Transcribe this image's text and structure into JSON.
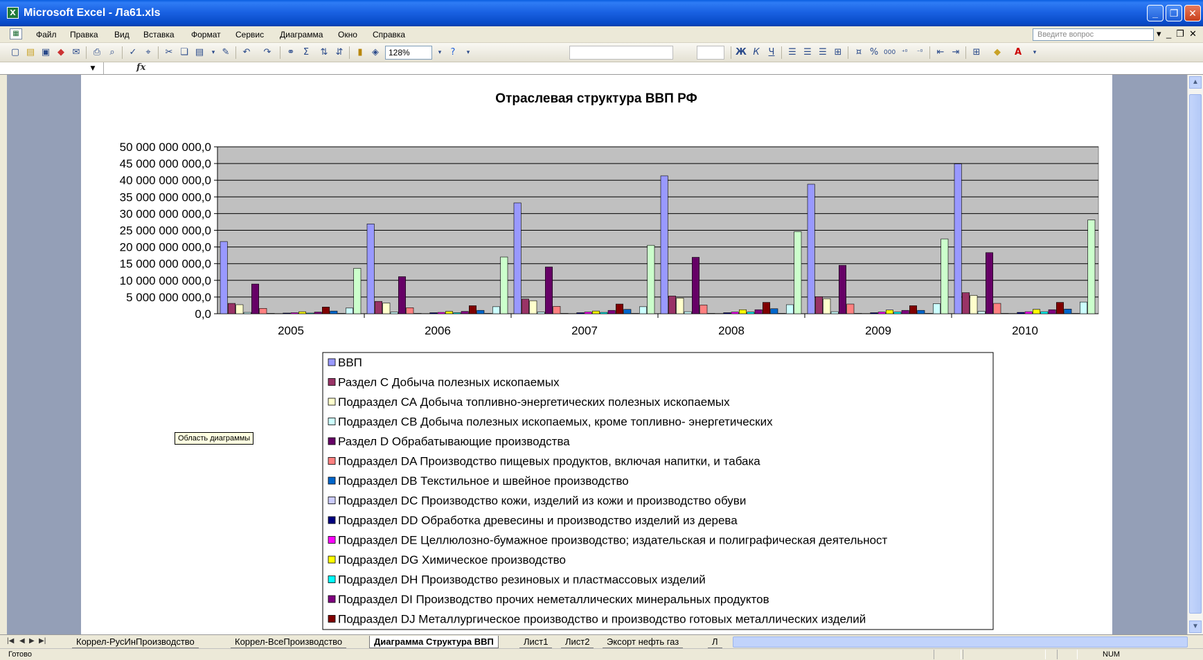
{
  "window": {
    "title": "Microsoft Excel - Ла61.xls",
    "app_icon": "excel-icon"
  },
  "menu": {
    "items": [
      "Файл",
      "Правка",
      "Вид",
      "Вставка",
      "Формат",
      "Сервис",
      "Диаграмма",
      "Окно",
      "Справка"
    ],
    "help_placeholder": "Введите вопрос"
  },
  "toolbar": {
    "zoom": "128%"
  },
  "formula_bar": {
    "fx_label": "fx"
  },
  "chart_data": {
    "type": "bar",
    "title": "Отраслевая структура ВВП РФ",
    "categories": [
      "2005",
      "2006",
      "2007",
      "2008",
      "2009",
      "2010"
    ],
    "ylim": [
      0,
      50000000000
    ],
    "yticks": [
      "0,0",
      "5 000 000 000,0",
      "10 000 000 000,0",
      "15 000 000 000,0",
      "20 000 000 000,0",
      "25 000 000 000,0",
      "30 000 000 000,0",
      "35 000 000 000,0",
      "40 000 000 000,0",
      "45 000 000 000,0",
      "50 000 000 000,0"
    ],
    "plot_background": "#c0c0c0",
    "gridlines": true,
    "legend_position": "bottom",
    "series": [
      {
        "name": "ВВП",
        "color": "#9999ff",
        "values": [
          21600000000,
          26900000000,
          33200000000,
          41300000000,
          38800000000,
          44900000000
        ]
      },
      {
        "name": "Раздел С Добыча полезных ископаемых",
        "color": "#993366",
        "values": [
          3100000000,
          3700000000,
          4400000000,
          5300000000,
          5100000000,
          6300000000
        ]
      },
      {
        "name": "Подраздел СА Добыча топливно-энергетических полезных ископаемых",
        "color": "#ffffcc",
        "values": [
          2700000000,
          3200000000,
          3900000000,
          4700000000,
          4500000000,
          5500000000
        ]
      },
      {
        "name": "Подраздел СВ Добыча полезных ископаемых, кроме топливно- энергетических",
        "color": "#ccffff",
        "values": [
          400000000,
          500000000,
          500000000,
          600000000,
          600000000,
          700000000
        ]
      },
      {
        "name": "Раздел D Обрабатывающие производства",
        "color": "#660066",
        "values": [
          8900000000,
          11100000000,
          14000000000,
          16900000000,
          14500000000,
          18300000000
        ]
      },
      {
        "name": "Подраздел DA Производство пищевых продуктов, включая напитки, и табака",
        "color": "#ff8080",
        "values": [
          1600000000,
          1800000000,
          2200000000,
          2600000000,
          2900000000,
          3100000000
        ]
      },
      {
        "name": "Подраздел DB Текстильное и швейное производство",
        "color": "#0066cc",
        "values": [
          100000000,
          100000000,
          100000000,
          100000000,
          100000000,
          100000000
        ]
      },
      {
        "name": "Подраздел DC Производство кожи, изделий из кожи и производство обуви",
        "color": "#ccccff",
        "values": [
          50000000,
          50000000,
          50000000,
          60000000,
          60000000,
          70000000
        ]
      },
      {
        "name": "Подраздел DD Обработка древесины и производство изделий из дерева",
        "color": "#000080",
        "values": [
          200000000,
          300000000,
          300000000,
          300000000,
          300000000,
          400000000
        ]
      },
      {
        "name": "Подраздел DE Целлюлозно-бумажное производство; издательская и полиграфическая деятельност",
        "color": "#ff00ff",
        "values": [
          300000000,
          400000000,
          500000000,
          500000000,
          500000000,
          600000000
        ]
      },
      {
        "name": "Подраздел DG Химическое производство",
        "color": "#ffff00",
        "values": [
          600000000,
          700000000,
          800000000,
          1200000000,
          1100000000,
          1300000000
        ]
      },
      {
        "name": "Подраздел DH Производство резиновых и пластмассовых изделий",
        "color": "#00ffff",
        "values": [
          200000000,
          300000000,
          400000000,
          500000000,
          500000000,
          600000000
        ]
      },
      {
        "name": "Подраздел DI Производство прочих неметаллических минеральных продуктов",
        "color": "#800080",
        "values": [
          500000000,
          700000000,
          1000000000,
          1200000000,
          1000000000,
          1200000000
        ]
      },
      {
        "name": "Подраздел DJ Металлургическое производство и производство готовых металлических изделий",
        "color": "#800000",
        "values": [
          2000000000,
          2400000000,
          2900000000,
          3400000000,
          2400000000,
          3400000000
        ]
      },
      {
        "name": "",
        "color": "#0066cc",
        "values": [
          800000000,
          1000000000,
          1300000000,
          1500000000,
          1000000000,
          1400000000
        ]
      },
      {
        "name": "",
        "color": "#c0c0c0",
        "values": [
          100000000,
          100000000,
          100000000,
          100000000,
          100000000,
          100000000
        ]
      },
      {
        "name": "",
        "color": "#ccffff",
        "values": [
          1700000000,
          2100000000,
          2100000000,
          2700000000,
          3000000000,
          3500000000
        ]
      },
      {
        "name": "",
        "color": "#ccffcc",
        "values": [
          13600000000,
          17000000000,
          20500000000,
          24600000000,
          22400000000,
          28100000000
        ]
      }
    ]
  },
  "tooltip": "Область диаграммы",
  "sheet_tabs": [
    "Коррел-РусИнПроизводство",
    "Коррел-ВсеПроизводство",
    "Диаграмма Структура ВВП",
    "Лист1",
    "Лист2",
    "Эксорт нефть газ",
    "Л"
  ],
  "active_tab": 2,
  "status": {
    "text": "Готово",
    "num": "NUM"
  }
}
